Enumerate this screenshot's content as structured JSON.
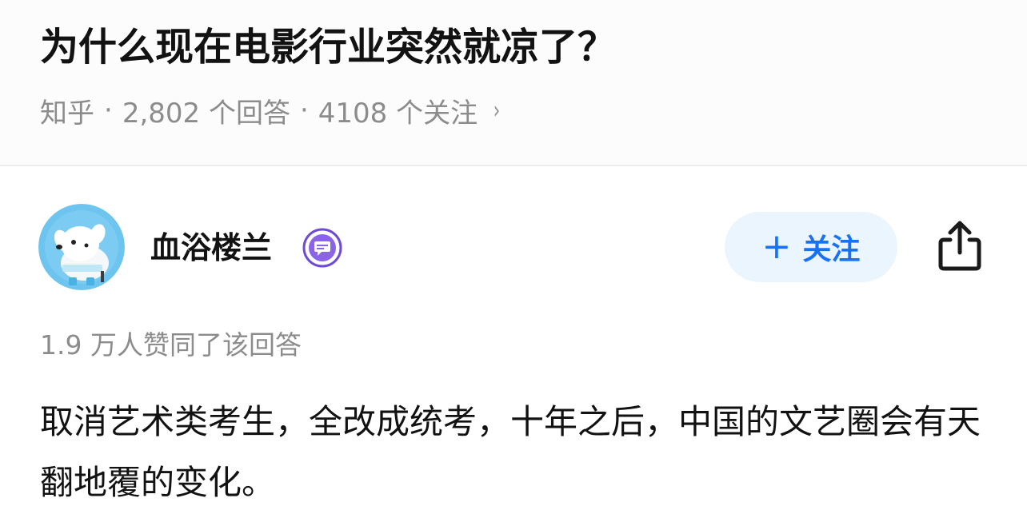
{
  "question": {
    "title": "为什么现在电影行业突然就凉了？",
    "source": "知乎",
    "separator": "·",
    "answers_count": "2,802 个回答",
    "followers_count": "4108 个关注",
    "more_chevron": "›"
  },
  "author": {
    "name": "血浴楼兰",
    "avatar_icon": "dog-astronaut-avatar",
    "badge_icon": "message-badge-icon"
  },
  "actions": {
    "follow_plus": "+",
    "follow_label": "关注",
    "share_icon": "share-icon"
  },
  "answer": {
    "upvote_text": "1.9 万人赞同了该回答",
    "body": "取消艺术类考生，全改成统考，十年之后，中国的文艺圈会有天翻地覆的变化。"
  },
  "colors": {
    "accent": "#1772f6",
    "follow_bg": "#ebf5fd",
    "meta_text": "#8c8c8c",
    "title_text": "#121212",
    "badge_purple": "#6e4bd6",
    "avatar_blue": "#6cc4ef"
  }
}
